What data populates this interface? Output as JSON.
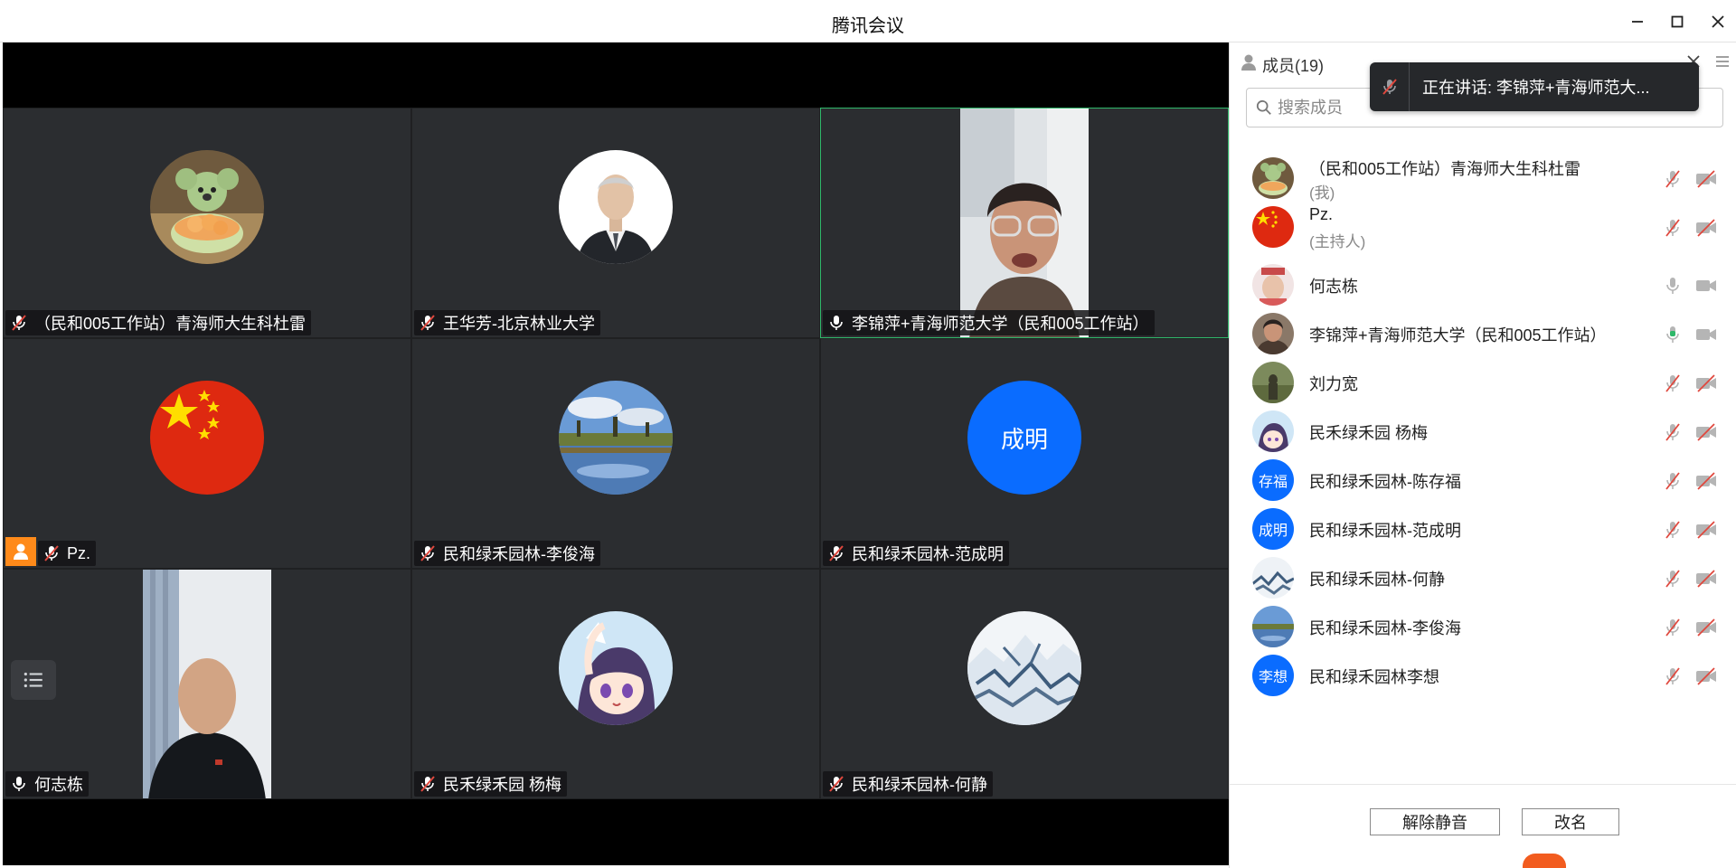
{
  "window": {
    "title": "腾讯会议"
  },
  "tiles": [
    {
      "name": "（民和005工作站）青海师大生科杜雷",
      "muted": true,
      "avatar": "koala-avatar"
    },
    {
      "name": "王华芳-北京林业大学",
      "muted": true,
      "avatar": "man-portrait-avatar"
    },
    {
      "name": "李锦萍+青海师范大学（民和005工作站）",
      "muted": false,
      "avatar": "video-woman"
    },
    {
      "name": "Pz.",
      "muted": true,
      "avatar": "china-flag-avatar",
      "host": true
    },
    {
      "name": "民和绿禾园林-李俊海",
      "muted": true,
      "avatar": "lake-avatar"
    },
    {
      "name": "民和绿禾园林-范成明",
      "muted": true,
      "avatar_text": "成明"
    },
    {
      "name": "何志栋",
      "muted": false,
      "avatar": "video-man"
    },
    {
      "name": "民禾绿禾园  杨梅",
      "muted": true,
      "avatar": "anime-girl-avatar"
    },
    {
      "name": "民和绿禾园林-何静",
      "muted": true,
      "avatar": "snow-mountain-avatar"
    }
  ],
  "panel": {
    "members_label": "成员(19)",
    "more": "···",
    "search_placeholder": "搜索成员",
    "speaking_toast": "正在讲话: 李锦萍+青海师范大...",
    "members": [
      {
        "name": "（民和005工作站）青海师大生科杜雷",
        "sub": "(我)",
        "mic": "muted",
        "cam": "off"
      },
      {
        "name": "Pz.",
        "sub": "(主持人)",
        "mic": "muted",
        "cam": "off"
      },
      {
        "name": "何志栋",
        "sub": "",
        "mic": "on",
        "cam": "on"
      },
      {
        "name": "李锦萍+青海师范大学（民和005工作站）",
        "sub": "",
        "mic": "speaking",
        "cam": "on"
      },
      {
        "name": "刘力宽",
        "sub": "",
        "mic": "muted",
        "cam": "off"
      },
      {
        "name": "民禾绿禾园  杨梅",
        "sub": "",
        "mic": "muted",
        "cam": "off"
      },
      {
        "name": "民和绿禾园林-陈存福",
        "sub": "",
        "mic": "muted",
        "cam": "off",
        "avatar_text": "存福"
      },
      {
        "name": "民和绿禾园林-范成明",
        "sub": "",
        "mic": "muted",
        "cam": "off",
        "avatar_text": "成明"
      },
      {
        "name": "民和绿禾园林-何静",
        "sub": "",
        "mic": "muted",
        "cam": "off"
      },
      {
        "name": "民和绿禾园林-李俊海",
        "sub": "",
        "mic": "muted",
        "cam": "off"
      },
      {
        "name": "民和绿禾园林李想",
        "sub": "",
        "mic": "muted",
        "cam": "off",
        "avatar_text": "李想"
      }
    ],
    "unmute_all_label": "解除静音",
    "rename_label": "改名"
  },
  "colors": {
    "accent_blue": "#0a6cff",
    "speaking_green": "#2fb86a",
    "muted_red": "#e0483e",
    "host_orange": "#ff8a1a"
  }
}
